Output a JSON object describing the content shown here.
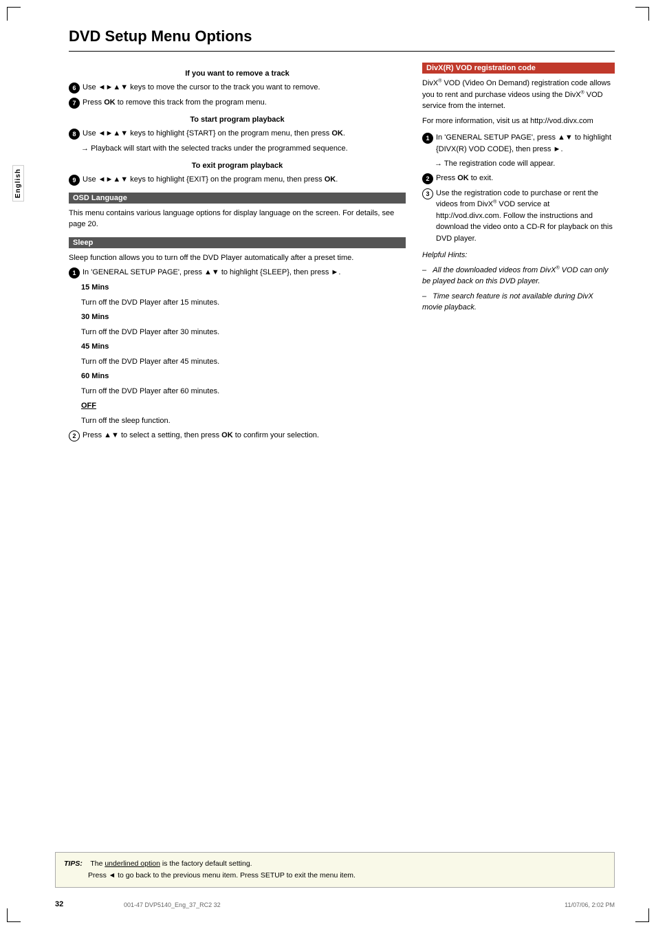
{
  "page": {
    "title": "DVD Setup Menu Options",
    "page_number": "32",
    "footer_code": "001-47 DVP5140_Eng_37_RC2        32",
    "footer_date": "11/07/06, 2:02 PM",
    "sidebar_label": "English"
  },
  "tips": {
    "label": "TIPS:",
    "line1": "The underlined option is the factory default setting.",
    "line2": "Press ◄ to go back to the previous menu item. Press SETUP to exit the menu item."
  },
  "left": {
    "remove_track_heading": "If you want to remove a track",
    "remove_track_items": [
      {
        "num": "6",
        "type": "filled",
        "text": "Use ◄►▲▼ keys to move the cursor to the track you want to remove."
      },
      {
        "num": "7",
        "type": "filled",
        "text": "Press OK to remove this track from the program menu."
      }
    ],
    "start_playback_heading": "To start program playback",
    "start_playback_items": [
      {
        "num": "8",
        "type": "filled",
        "text": "Use ◄►▲▼ keys to highlight {START} on the program menu, then press OK.",
        "arrow": "Playback will start with the selected tracks under the programmed sequence."
      }
    ],
    "exit_playback_heading": "To exit program playback",
    "exit_playback_items": [
      {
        "num": "9",
        "type": "filled",
        "text": "Use ◄►▲▼ keys to highlight {EXIT} on the program menu, then press OK."
      }
    ],
    "osd_heading": "OSD Language",
    "osd_text": "This menu contains various language options for display language on the screen. For details, see page 20.",
    "sleep_heading": "Sleep",
    "sleep_intro": "Sleep function allows you to turn off the DVD Player automatically after a preset time.",
    "sleep_step1": {
      "num": "1",
      "type": "filled",
      "text": "In 'GENERAL SETUP PAGE', press ▲▼ to highlight {SLEEP}, then press ►."
    },
    "sleep_options": [
      {
        "label": "15 Mins",
        "bold": true,
        "text": "Turn off the DVD Player after 15 minutes."
      },
      {
        "label": "30 Mins",
        "bold": true,
        "text": "Turn off the DVD Player after 30 minutes."
      },
      {
        "label": "45 Mins",
        "bold": true,
        "text": "Turn off the DVD Player after 45 minutes."
      },
      {
        "label": "60 Mins",
        "bold": true,
        "text": "Turn off the DVD Player after 60 minutes."
      },
      {
        "label": "OFF",
        "bold": true,
        "underline": true,
        "text": "Turn off the sleep function."
      }
    ],
    "sleep_step2": {
      "num": "2",
      "type": "outline",
      "text": "Press ▲▼ to select a setting, then press OK to confirm your selection."
    }
  },
  "right": {
    "divx_heading": "DivX(R) VOD registration code",
    "divx_intro": "DivX® VOD (Video On Demand) registration code allows you to rent and purchase videos using the DivX® VOD service from the internet.",
    "divx_visit": "For more information, visit us at http://vod.divx.com",
    "divx_steps": [
      {
        "num": "1",
        "type": "filled",
        "text": "In 'GENERAL SETUP PAGE', press ▲▼ to highlight {DIVX(R) VOD CODE}, then press ►.",
        "arrow": "The registration code will appear."
      },
      {
        "num": "2",
        "type": "filled",
        "text": "Press OK to exit."
      },
      {
        "num": "3",
        "type": "outline",
        "text": "Use the registration code to purchase or rent the videos from DivX® VOD service at http://vod.divx.com. Follow the instructions and download the video onto a CD-R for playback on this DVD player."
      }
    ],
    "helpful_hints_label": "Helpful Hints:",
    "hints": [
      "All the downloaded videos from DivX® VOD can only be played back on this DVD player.",
      "Time search feature is not available during DivX movie playback."
    ]
  }
}
